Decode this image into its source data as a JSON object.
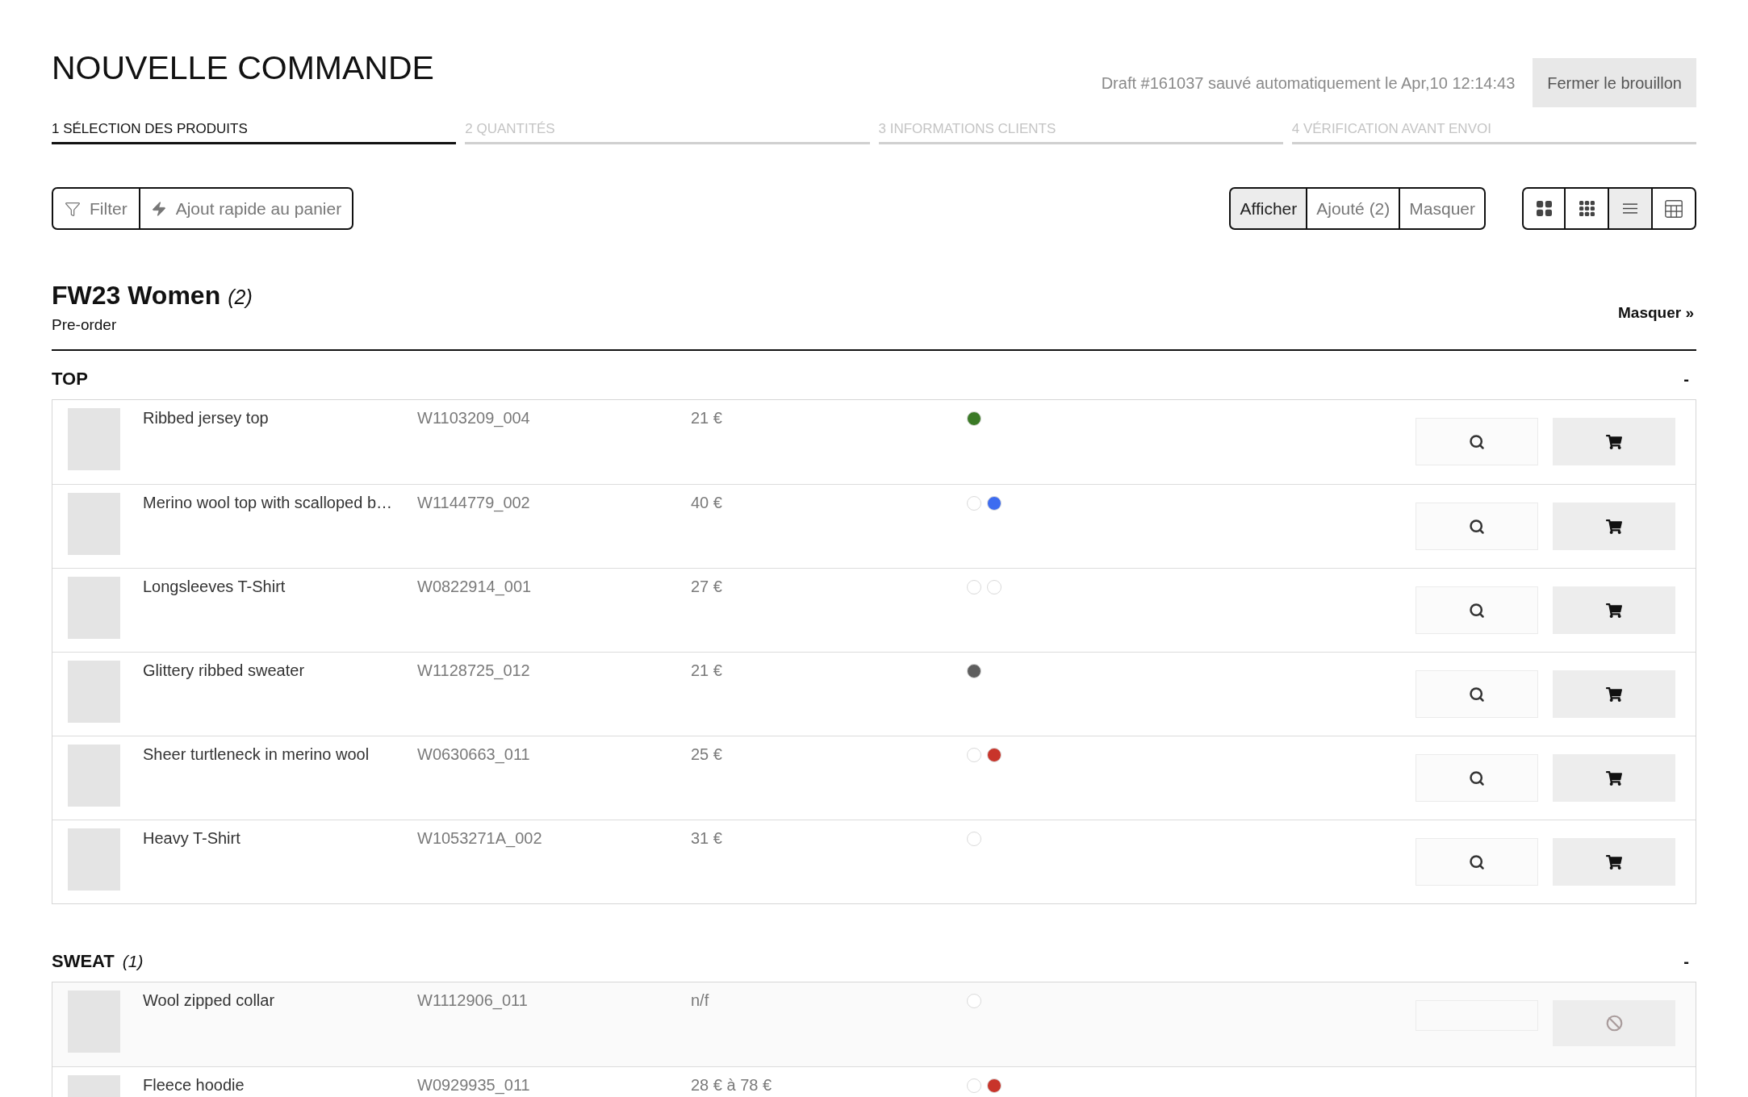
{
  "header": {
    "title": "NOUVELLE COMMANDE",
    "draft_status": "Draft #161037 sauvé automatiquement le Apr,10 12:14:43",
    "close_button": "Fermer le brouillon"
  },
  "steps": [
    {
      "label": "1 SÉLECTION DES PRODUITS",
      "selected": true
    },
    {
      "label": "2 QUANTITÉS",
      "selected": false
    },
    {
      "label": "3 INFORMATIONS CLIENTS",
      "selected": false
    },
    {
      "label": "4 VÉRIFICATION AVANT ENVOI",
      "selected": false
    }
  ],
  "toolbar": {
    "actions": [
      {
        "kind": "filter",
        "label": "Filter"
      },
      {
        "kind": "quick_add",
        "label": "Ajout rapide au panier"
      }
    ],
    "display_filter": [
      {
        "label": "Afficher",
        "selected": true
      },
      {
        "label": "Ajouté (2)",
        "selected": false
      },
      {
        "label": "Masquer",
        "selected": false
      }
    ],
    "view_modes": [
      {
        "kind": "large_grid",
        "selected": false
      },
      {
        "kind": "small_grid",
        "selected": false
      },
      {
        "kind": "list",
        "selected": true
      },
      {
        "kind": "table",
        "selected": false
      }
    ]
  },
  "collection": {
    "title": "FW23 Women",
    "count": "(2)",
    "subtitle": "Pre-order",
    "hide_link": "Masquer »"
  },
  "groups": [
    {
      "title": "TOP",
      "toggle": "-",
      "products": [
        {
          "kind": "orderable",
          "name": "Ribbed jersey top",
          "sku": "W1103209_004",
          "price": "21 €",
          "colors": [
            {
              "color": "#3b7a26"
            }
          ]
        },
        {
          "kind": "orderable",
          "name": "Merino wool top with scalloped b…",
          "sku": "W1144779_002",
          "price": "40 €",
          "colors": [
            {
              "color": "#ffffff"
            },
            {
              "color": "#3d6cf0"
            }
          ]
        },
        {
          "kind": "orderable",
          "name": "Longsleeves T-Shirt",
          "sku": "W0822914_001",
          "price": "27 €",
          "colors": [
            {
              "color": "#ffffff"
            },
            {
              "color": "#ffffff"
            }
          ]
        },
        {
          "kind": "orderable",
          "name": "Glittery ribbed sweater",
          "sku": "W1128725_012",
          "price": "21 €",
          "colors": [
            {
              "color": "#5e5e5e"
            }
          ]
        },
        {
          "kind": "orderable",
          "name": "Sheer turtleneck in merino wool",
          "sku": "W0630663_011",
          "price": "25 €",
          "colors": [
            {
              "color": "#ffffff"
            },
            {
              "color": "#c8342a"
            }
          ]
        },
        {
          "kind": "orderable",
          "name": "Heavy T-Shirt",
          "sku": "W1053271A_002",
          "price": "31 €",
          "colors": [
            {
              "color": "#ffffff"
            }
          ]
        }
      ]
    },
    {
      "title": "SWEAT",
      "count": "(1)",
      "toggle": "-",
      "products": [
        {
          "kind": "unavailable",
          "name": "Wool zipped collar",
          "sku": "W1112906_011",
          "price": "n/f",
          "colors": [
            {
              "color": "#ffffff"
            }
          ]
        },
        {
          "name": "Fleece hoodie",
          "sku": "W0929935_011",
          "price": "28 € à 78 €",
          "colors": [
            {
              "color": "#ffffff"
            },
            {
              "color": "#c8342a"
            }
          ]
        }
      ]
    }
  ]
}
